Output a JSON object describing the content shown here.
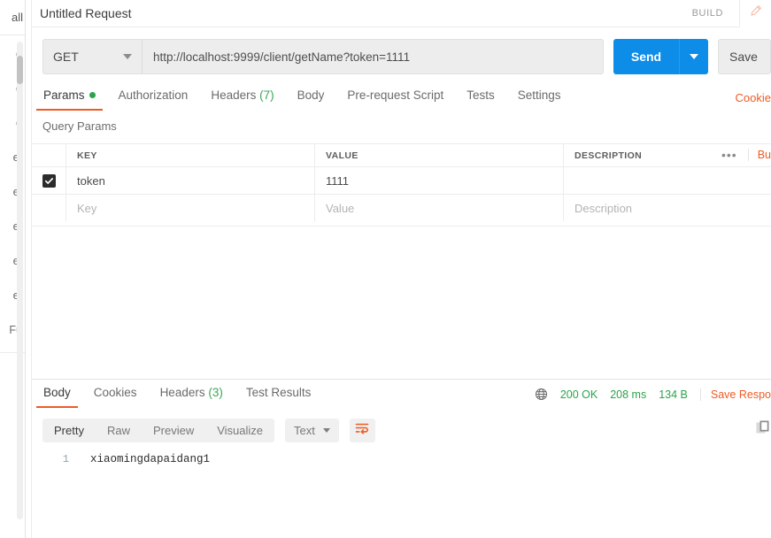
{
  "sidebar": {
    "top_fragment": "all",
    "item_fragments": [
      "o",
      "o",
      "o",
      "et",
      "et",
      "et",
      "et",
      "et",
      "Fu"
    ]
  },
  "header": {
    "request_title": "Untitled Request",
    "build_label": "BUILD",
    "edit_icon": "pencil-icon"
  },
  "url_bar": {
    "method": "GET",
    "url": "http://localhost:9999/client/getName?token=1111",
    "send_label": "Send",
    "save_label": "Save"
  },
  "request_tabs": {
    "items": [
      {
        "label": "Params",
        "badge": "",
        "dot": true,
        "active": true
      },
      {
        "label": "Authorization",
        "badge": "",
        "dot": false,
        "active": false
      },
      {
        "label": "Headers",
        "badge": "(7)",
        "dot": false,
        "active": false
      },
      {
        "label": "Body",
        "badge": "",
        "dot": false,
        "active": false
      },
      {
        "label": "Pre-request Script",
        "badge": "",
        "dot": false,
        "active": false
      },
      {
        "label": "Tests",
        "badge": "",
        "dot": false,
        "active": false
      },
      {
        "label": "Settings",
        "badge": "",
        "dot": false,
        "active": false
      }
    ],
    "cookies_link": "Cookie"
  },
  "query_params": {
    "section_label": "Query Params",
    "columns": [
      "KEY",
      "VALUE",
      "DESCRIPTION"
    ],
    "bulk_edit_label": "Bu",
    "more_label": "•••",
    "rows": [
      {
        "checked": true,
        "key": "token",
        "value": "1111",
        "description": ""
      }
    ],
    "placeholder_row": {
      "key": "Key",
      "value": "Value",
      "description": "Description"
    }
  },
  "response": {
    "tabs": [
      {
        "label": "Body",
        "badge": "",
        "active": true
      },
      {
        "label": "Cookies",
        "badge": "",
        "active": false
      },
      {
        "label": "Headers",
        "badge": "(3)",
        "active": false
      },
      {
        "label": "Test Results",
        "badge": "",
        "active": false
      }
    ],
    "globe_icon": "globe-icon",
    "status": "200 OK",
    "time": "208 ms",
    "size": "134 B",
    "save_response_label": "Save Respo",
    "view_modes": [
      {
        "label": "Pretty",
        "active": true
      },
      {
        "label": "Raw",
        "active": false
      },
      {
        "label": "Preview",
        "active": false
      },
      {
        "label": "Visualize",
        "active": false
      }
    ],
    "format": "Text",
    "wrap_icon": "word-wrap-icon",
    "copy_icon": "copy-icon",
    "body_lines": [
      {
        "num": "1",
        "text": "xiaomingdapaidang1"
      }
    ]
  },
  "colors": {
    "accent_orange": "#ef5b25",
    "send_blue": "#0d8ce8",
    "status_green": "#2aa34a"
  }
}
